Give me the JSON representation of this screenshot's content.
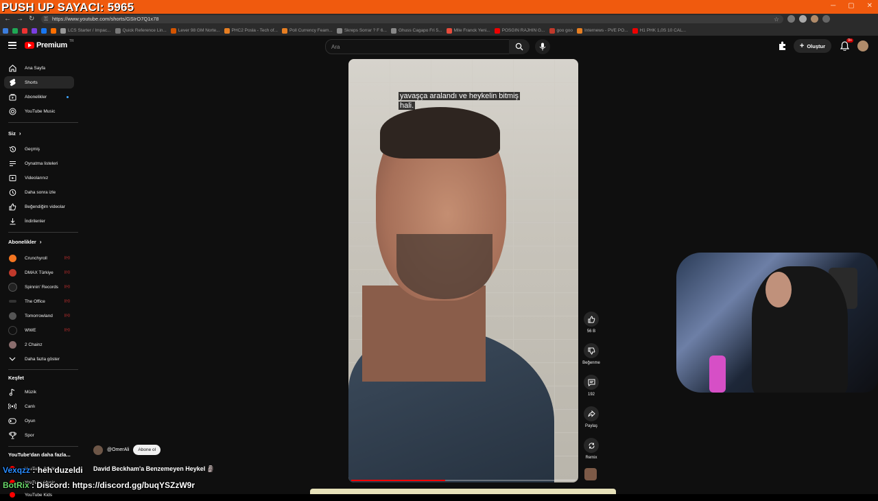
{
  "overlay": {
    "counter": "PUSH UP SAYACI: 5965"
  },
  "browser": {
    "url": "https://www.youtube.com/shorts/GSIrO7Q1x78",
    "bookmarks": [
      "LCS Starter / Impac...",
      "Quick Reference Lin...",
      "Lever 98 GM Norte...",
      "PHC2 Posla - Tech of...",
      "Poll Currency Feam...",
      "Skreps Sorrar ? F 6...",
      "Ghuss Cagapo Fri 5...",
      "Mlle Franck Yeni...",
      "POSGIN RAJHIN G...",
      "goo goo",
      "Internews - PVE PO...",
      "H1 PHK 1,0S 10 CAL..."
    ]
  },
  "header": {
    "logo": "Premium",
    "logo_cc": "TR",
    "search_placeholder": "Ara",
    "create_label": "Oluştur",
    "notif_badge": "9+"
  },
  "sidebar": {
    "main": [
      {
        "label": "Ana Sayfa",
        "icon": "home-icon"
      },
      {
        "label": "Shorts",
        "icon": "shorts-icon"
      },
      {
        "label": "Abonelikler",
        "icon": "subscriptions-icon"
      },
      {
        "label": "YouTube Music",
        "icon": "music-icon"
      }
    ],
    "you_title": "Siz",
    "you": [
      {
        "label": "Geçmiş",
        "icon": "history-icon"
      },
      {
        "label": "Oynatma listeleri",
        "icon": "playlist-icon"
      },
      {
        "label": "Videolarınız",
        "icon": "video-icon"
      },
      {
        "label": "Daha sonra izle",
        "icon": "clock-icon"
      },
      {
        "label": "Beğendiğim videolar",
        "icon": "like-icon"
      },
      {
        "label": "İndirilenler",
        "icon": "download-icon"
      }
    ],
    "subs_title": "Abonelikler",
    "subs": [
      {
        "label": "Crunchyroll",
        "color": "#f47521"
      },
      {
        "label": "DMAX Türkiye",
        "color": "#c0392b"
      },
      {
        "label": "Spinnin' Records",
        "color": "#222222"
      },
      {
        "label": "The Office",
        "color": "#333333"
      },
      {
        "label": "Tomorrowland",
        "color": "#555555"
      },
      {
        "label": "WWE",
        "color": "#111111"
      },
      {
        "label": "2 Chainz",
        "color": "#8a6d6d"
      }
    ],
    "more_label": "Daha fazla göster",
    "explore_title": "Keşfet",
    "explore": [
      {
        "label": "Müzik",
        "icon": "music-note-icon"
      },
      {
        "label": "Canlı",
        "icon": "live-icon"
      },
      {
        "label": "Oyun",
        "icon": "gamepad-icon"
      },
      {
        "label": "Spor",
        "icon": "trophy-icon"
      }
    ],
    "more_from_title": "YouTube'dan daha fazla...",
    "more_from": [
      {
        "label": "YouTube Studio"
      },
      {
        "label": "YouTube Music"
      },
      {
        "label": "YouTube Kids"
      }
    ]
  },
  "video": {
    "caption_line1": "yavaşça aralandı ve heykelin bitmiş",
    "caption_line2": "hali.",
    "progress": 0.42,
    "channel": "@OmerAli",
    "subscribe_label": "Abone ol",
    "title": "David Beckham'a Benzemeyen Heykel 🗿"
  },
  "actions": {
    "likes": "56 B",
    "dislike_label": "Beğenme",
    "comments": "192",
    "share_label": "Paylaş",
    "remix_label": "Remix"
  },
  "chat": [
    {
      "user": "Vexqzz",
      "message": " : heh duzeldi"
    },
    {
      "user": "BotRix",
      "message": " : Discord: https://discord.gg/buqYSZzW9r"
    }
  ]
}
